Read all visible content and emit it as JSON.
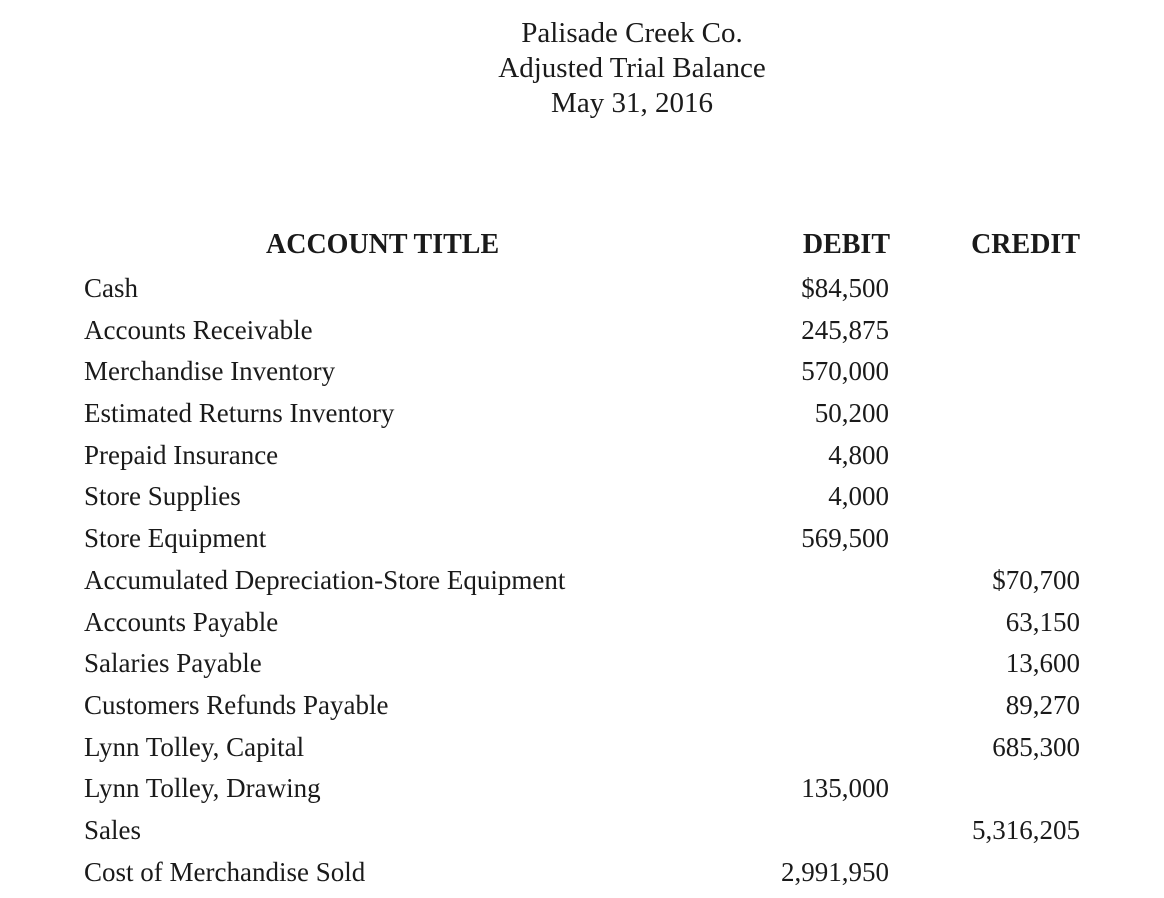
{
  "header": {
    "company": "Palisade Creek Co.",
    "statement": "Adjusted Trial Balance",
    "date": "May 31, 2016"
  },
  "columns": {
    "account_title": "ACCOUNT TITLE",
    "debit": "DEBIT",
    "credit": "CREDIT"
  },
  "rows": [
    {
      "account": "Cash",
      "debit": "$84,500",
      "credit": ""
    },
    {
      "account": "Accounts Receivable",
      "debit": "245,875",
      "credit": ""
    },
    {
      "account": "Merchandise Inventory",
      "debit": "570,000",
      "credit": ""
    },
    {
      "account": "Estimated Returns Inventory",
      "debit": "50,200",
      "credit": ""
    },
    {
      "account": "Prepaid Insurance",
      "debit": "4,800",
      "credit": ""
    },
    {
      "account": "Store Supplies",
      "debit": "4,000",
      "credit": ""
    },
    {
      "account": "Store Equipment",
      "debit": "569,500",
      "credit": ""
    },
    {
      "account": "Accumulated Depreciation-Store Equipment",
      "debit": "",
      "credit": "$70,700"
    },
    {
      "account": "Accounts Payable",
      "debit": "",
      "credit": "63,150"
    },
    {
      "account": "Salaries Payable",
      "debit": "",
      "credit": "13,600"
    },
    {
      "account": "Customers Refunds Payable",
      "debit": "",
      "credit": "89,270"
    },
    {
      "account": "Lynn Tolley, Capital",
      "debit": "",
      "credit": "685,300"
    },
    {
      "account": "Lynn Tolley, Drawing",
      "debit": "135,000",
      "credit": ""
    },
    {
      "account": "Sales",
      "debit": "",
      "credit": "5,316,205"
    },
    {
      "account": "Cost of Merchandise Sold",
      "debit": "2,991,950",
      "credit": ""
    }
  ]
}
